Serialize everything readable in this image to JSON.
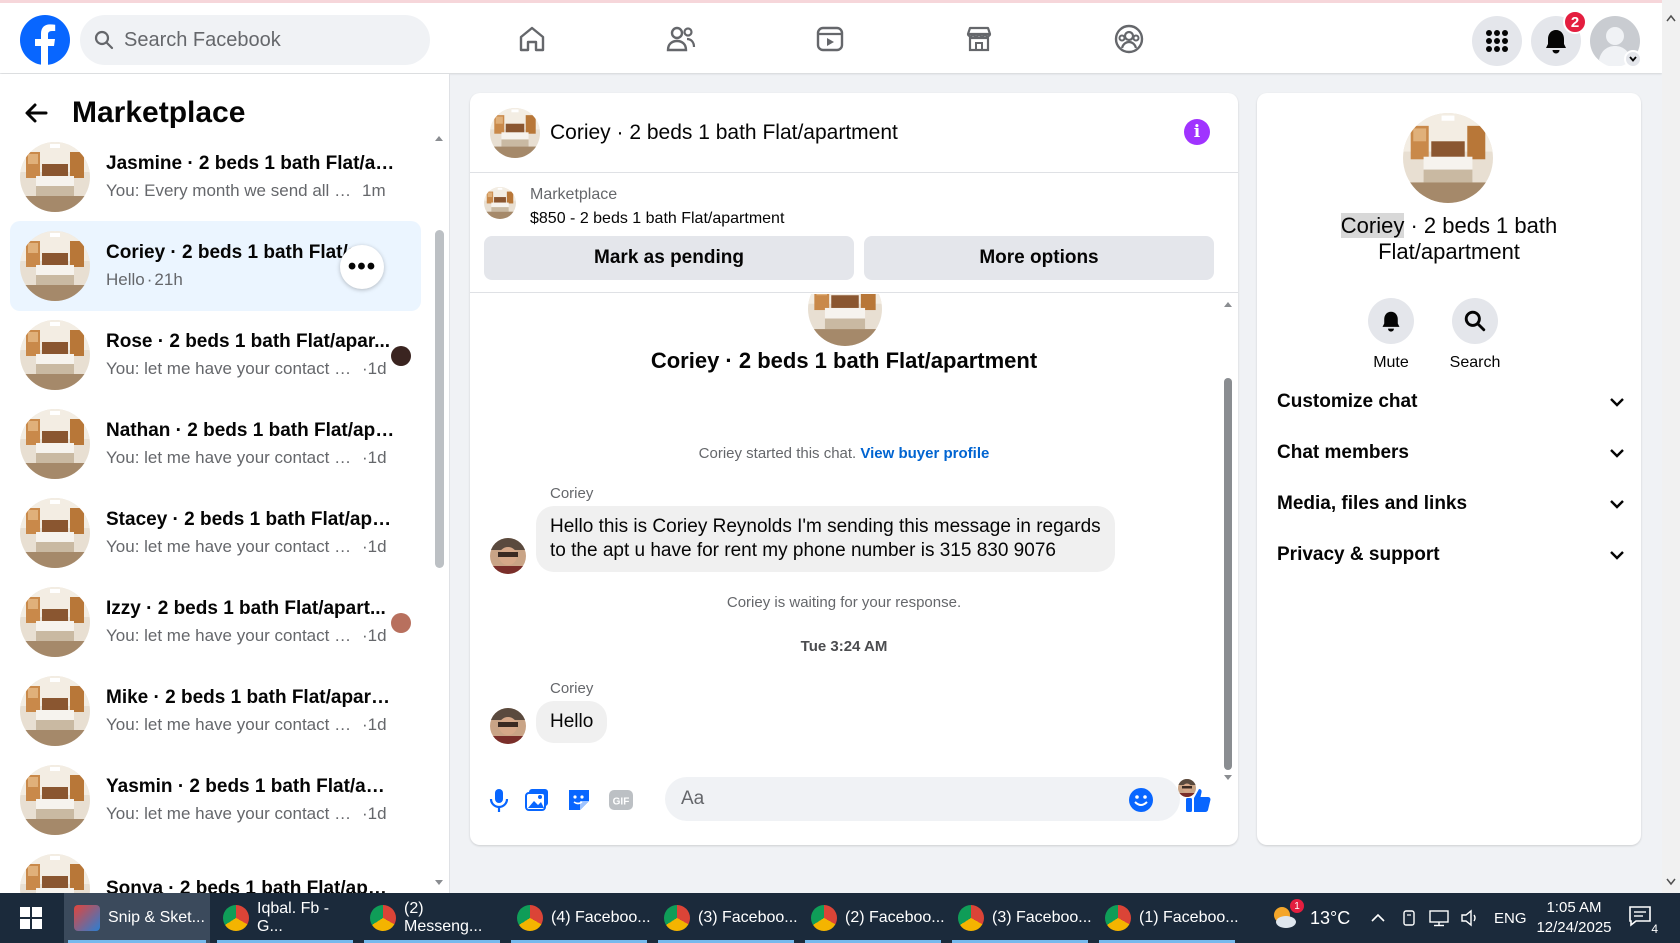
{
  "colors": {
    "brand": "#0866ff",
    "accent_purple": "#a033ff",
    "link": "#0064d1",
    "badge": "#e41e3f"
  },
  "topbar": {
    "search_placeholder": "Search Facebook",
    "notification_count": "2",
    "nav_icons": [
      "home-icon",
      "friends-icon",
      "video-icon",
      "marketplace-icon",
      "groups-icon"
    ]
  },
  "sidebar": {
    "title": "Marketplace",
    "conversations": [
      {
        "name": "Jasmine · 2 beds 1 bath Flat/apa...",
        "preview": "You: Every month we send all our c...",
        "time": "1m"
      },
      {
        "name": "Coriey · 2 beds 1 bath Flat/ar",
        "preview": "Hello",
        "time": "21h",
        "sep": "·"
      },
      {
        "name": "Rose · 2 beds 1 bath Flat/apar...",
        "preview": "You: let me have your contact n...",
        "time": "·1d"
      },
      {
        "name": "Nathan · 2 beds 1 bath Flat/apar...",
        "preview": "You: let me have your contact num...",
        "time": "·1d"
      },
      {
        "name": "Stacey · 2 beds 1 bath Flat/apart...",
        "preview": "You: let me have your contact num...",
        "time": "·1d"
      },
      {
        "name": "Izzy · 2 beds 1 bath Flat/apart...",
        "preview": "You: let me have your contact n...",
        "time": "·1d"
      },
      {
        "name": "Mike · 2 beds 1 bath Flat/apartm...",
        "preview": "You: let me have your contact num...",
        "time": "·1d"
      },
      {
        "name": "Yasmin · 2 beds 1 bath Flat/apart...",
        "preview": "You: let me have your contact num...",
        "time": "·1d"
      },
      {
        "name": "Sonya · 2 beds 1 bath Flat/apart...",
        "preview": "",
        "time": ""
      }
    ]
  },
  "chat": {
    "title": "Coriey · 2 beds 1 bath Flat/apartment",
    "listing_label": "Marketplace",
    "listing_price": "$850 - 2 beds 1 bath Flat/apartment",
    "mark_pending": "Mark as pending",
    "more_options": "More options",
    "started_text": "Coriey started this chat.",
    "view_buyer": "View buyer profile",
    "sender": "Coriey",
    "message1_line1": "Hello this is Coriey Reynolds I'm sending this message in regards",
    "message1_line2": "to the apt u have for rent my phone number is 315 830 9076",
    "waiting": "Coriey is waiting for your response.",
    "timestamp": "Tue 3:24 AM",
    "message2": "Hello",
    "composer_placeholder": "Aa"
  },
  "right_panel": {
    "name_highlight": "Coriey",
    "name_rest1": " · 2 beds 1 bath",
    "name_line2": "Flat/apartment",
    "mute": "Mute",
    "search": "Search",
    "sections": [
      "Customize chat",
      "Chat members",
      "Media, files and links",
      "Privacy & support"
    ]
  },
  "taskbar": {
    "items": [
      {
        "label": "Snip & Sket...",
        "active": true
      },
      {
        "label": "Iqbal. Fb - G..."
      },
      {
        "label": "(2) Messeng..."
      },
      {
        "label": "(4) Faceboo..."
      },
      {
        "label": "(3) Faceboo..."
      },
      {
        "label": "(2) Faceboo..."
      },
      {
        "label": "(3) Faceboo..."
      },
      {
        "label": "(1) Faceboo..."
      }
    ],
    "temperature": "13°C",
    "weather_badge": "1",
    "language": "ENG",
    "time": "1:05 AM",
    "date": "12/24/2025",
    "notif_count": "4"
  }
}
